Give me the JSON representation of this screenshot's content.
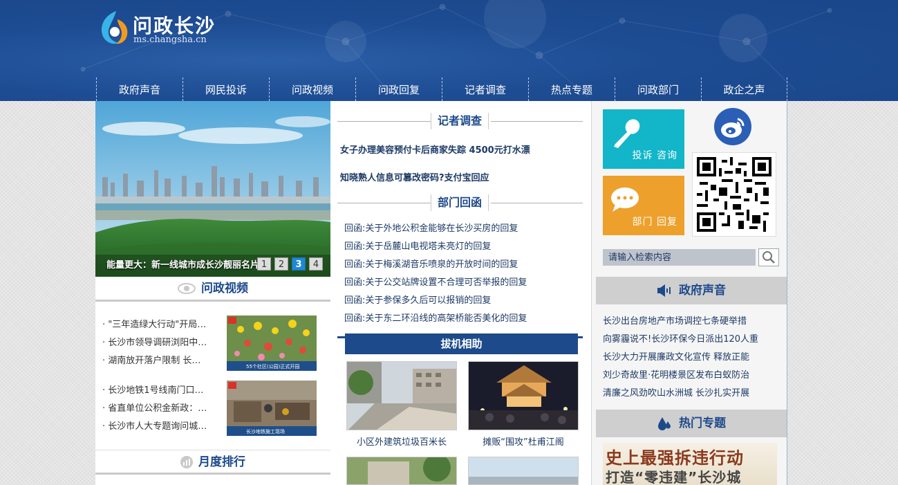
{
  "header": {
    "site_title": "问政长沙",
    "site_domain": "ms.changsha.cn"
  },
  "nav": [
    "政府声音",
    "网民投诉",
    "问政视频",
    "问政回复",
    "记者调查",
    "热点专题",
    "问政部门",
    "政企之声"
  ],
  "banner": {
    "caption": "能量更大：新一线城市成长沙靓丽名片",
    "pager": [
      "1",
      "2",
      "3",
      "4"
    ],
    "active_page": "3"
  },
  "video_section": {
    "title": "问政视频",
    "list1": [
      "· \"三年造绿大行动\"开局…",
      "· 长沙市领导调研浏阳中…",
      "· 湖南放开落户限制 长…"
    ],
    "list2": [
      "· 长沙地铁1号线南门口…",
      "· 省直单位公积金新政：…",
      "· 长沙市人大专题询问城…"
    ],
    "thumb1_caption": "55个社区(公园)正式开园",
    "thumb2_caption": "长沙地铁施工现场"
  },
  "monthly_rank": {
    "title": "月度排行"
  },
  "reporter": {
    "title": "记者调查",
    "headlines": [
      "女子办理美容预付卡后商家失踪 4500元打水漂",
      "知晓熟人信息可篡改密码?支付宝回应"
    ]
  },
  "dept_reply": {
    "title": "部门回函",
    "items": [
      "回函:关于外地公积金能够在长沙买房的回复",
      "回函:关于岳麓山电视塔未亮灯的回复",
      "回函:关于梅溪湖音乐喷泉的开放时间的回复",
      "回函:关于公交站牌设置不合理可否举报的回复",
      "回函:关于参保多久后可以报销的回复",
      "回函:关于东二环沿线的高架桥能否美化的回复"
    ]
  },
  "anjian": {
    "title": "拔机相助",
    "captions": [
      "小区外建筑垃圾百米长",
      "摊贩“围攻”杜甫江阁"
    ]
  },
  "right": {
    "tile_complaint": "投诉 咨询",
    "tile_reply": "部门 回复",
    "search_placeholder": "请输入检索内容",
    "gov_voice_title": "政府声音",
    "gov_voice_items": [
      "长沙出台房地产市场调控七条硬举措",
      "向雾霾说不!长沙环保今日派出120人重",
      "长沙大力开展廉政文化宣传 释放正能",
      "刘少奇故里·花明楼景区发布白蚁防治",
      "清廉之风劲吹山水洲城 长沙扎实开展"
    ],
    "hot_topic_title": "热门专题",
    "topic_line1": "史上最强拆违行动",
    "topic_line2": "打造“零违建”长沙城"
  },
  "colors": {
    "header_blue": "#1d4c92",
    "tile_cyan": "#12b6c8",
    "tile_orange": "#eda02b",
    "pager_active": "#1e88d6",
    "heading_text": "#1d4a8b"
  }
}
